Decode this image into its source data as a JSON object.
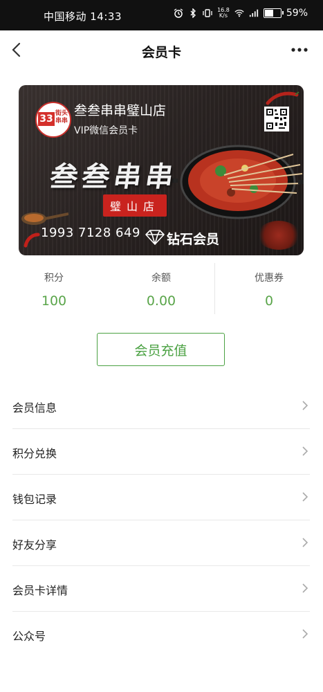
{
  "status_bar": {
    "carrier_time": "中国移动 14:33",
    "net_speed_top": "16.8",
    "net_speed_bottom": "K/s",
    "battery": "59%",
    "battery_level": 0.59,
    "icons": [
      "alarm-icon",
      "bluetooth-icon",
      "vibrate-icon",
      "wifi-icon",
      "signal-icon",
      "battery-icon"
    ]
  },
  "nav": {
    "title": "会员卡",
    "back_icon": "chevron-left-icon",
    "more_icon": "more-icon"
  },
  "card": {
    "logo_number": "33",
    "logo_text": "街头串串",
    "store_name": "叁叁串串璧山店",
    "card_type": "VIP微信会员卡",
    "calligraphy": "叁叁串串",
    "branch_stamp": "璧山店",
    "card_number": "1993 7128 649",
    "level": "钻石会员",
    "colors": {
      "accent_red": "#c9231e"
    }
  },
  "stats": [
    {
      "label": "积分",
      "value": "100"
    },
    {
      "label": "余额",
      "value": "0.00"
    },
    {
      "label": "优惠券",
      "value": "0"
    }
  ],
  "recharge_button": "会员充值",
  "menu": [
    {
      "label": "会员信息"
    },
    {
      "label": "积分兑换"
    },
    {
      "label": "钱包记录"
    },
    {
      "label": "好友分享"
    },
    {
      "label": "会员卡详情"
    },
    {
      "label": "公众号"
    }
  ],
  "colors": {
    "accent_green": "#4aa142",
    "value_green": "#5aa54a",
    "status_bar_bg": "#111111"
  }
}
